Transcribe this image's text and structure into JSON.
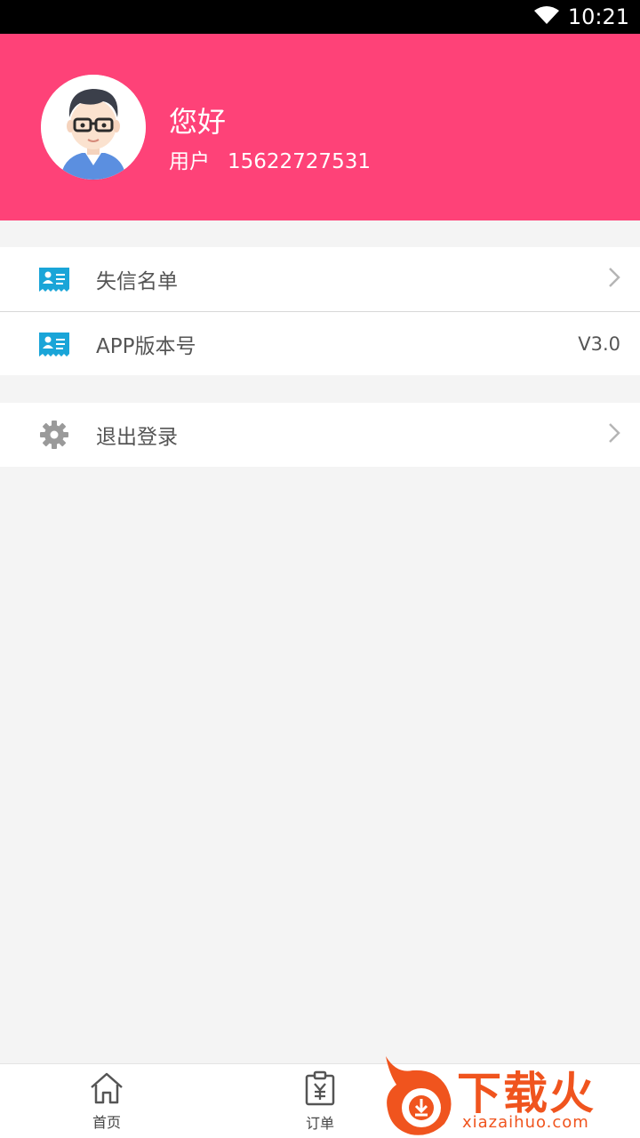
{
  "status_bar": {
    "time": "10:21",
    "wifi_icon": "wifi-icon"
  },
  "header": {
    "greeting": "您好",
    "user_label": "用户",
    "phone": "15622727531",
    "avatar": "avatar-glasses-man",
    "background": "#fe4278"
  },
  "menu": {
    "items": [
      {
        "label": "失信名单",
        "icon": "id-card-icon",
        "right": "chevron-right-icon"
      },
      {
        "label": "APP版本号",
        "icon": "id-card-icon",
        "value": "V3.0"
      }
    ],
    "logout": {
      "label": "退出登录",
      "icon": "gear-icon",
      "right": "chevron-right-icon"
    }
  },
  "bottom_nav": {
    "items": [
      {
        "label": "首页",
        "icon": "home-icon"
      },
      {
        "label": "订单",
        "icon": "order-clipboard-icon"
      }
    ]
  },
  "watermark": {
    "title": "下载火",
    "url": "xiazaihuo.com",
    "color": "#f0541e"
  }
}
